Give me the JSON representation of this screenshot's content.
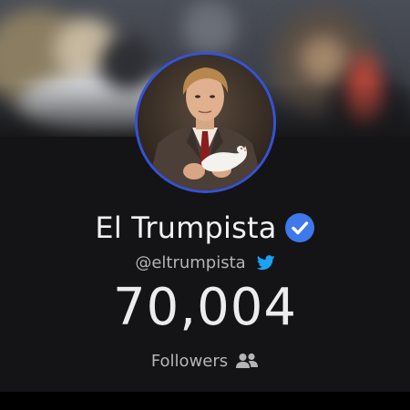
{
  "profile": {
    "name": "El Trumpista",
    "handle": "@eltrumpista",
    "followers_count": "70,004",
    "followers_label": "Followers",
    "verified": true
  },
  "icons": {
    "verified": "verified-badge-icon",
    "twitter": "twitter-bird-icon",
    "followers": "people-icon"
  },
  "colors": {
    "background": "#141416",
    "avatar_ring": "#3553d6",
    "verified_badge": "#3f78ea",
    "twitter_blue": "#1da1f2",
    "text_primary": "#f2f2f2",
    "text_secondary": "#b3b3b3"
  }
}
